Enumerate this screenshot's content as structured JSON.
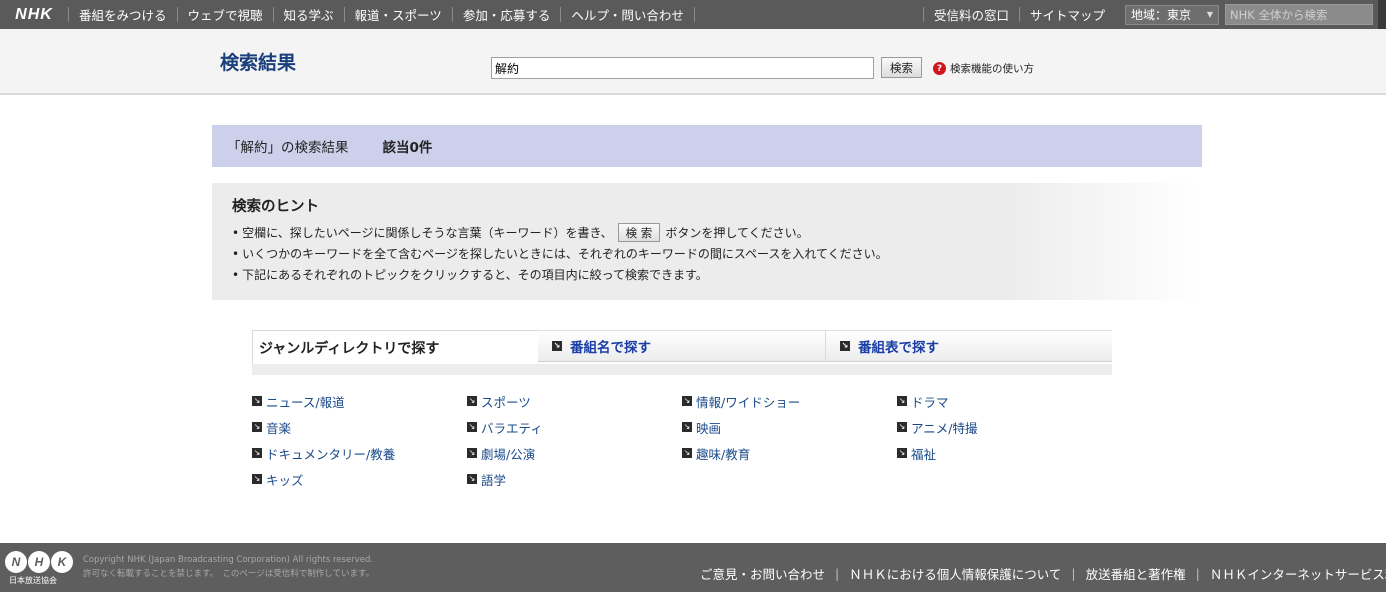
{
  "topnav": {
    "logo": "NHK",
    "items": [
      "番組をみつける",
      "ウェブで視聴",
      "知る学ぶ",
      "報道・スポーツ",
      "参加・応募する",
      "ヘルプ・問い合わせ"
    ],
    "right_items": [
      "受信料の窓口",
      "サイトマップ"
    ],
    "region_label": "地域：東京",
    "site_search_placeholder": "NHK 全体から検索"
  },
  "header": {
    "title": "検索結果",
    "query": "解約",
    "search_button": "検索",
    "help_link": "検索機能の使い方",
    "help_icon_glyph": "?"
  },
  "results": {
    "label": "「解約」の検索結果",
    "count": "該当0件"
  },
  "hints": {
    "title": "検索のヒント",
    "line1_before": "空欄に、探したいページに関係しそうな言葉（キーワード）を書き、",
    "line1_button": "検 索",
    "line1_after": "ボタンを押してください。",
    "line2": "いくつかのキーワードを全て含むページを探したいときには、それぞれのキーワードの間にスペースを入れてください。",
    "line3": "下記にあるそれぞれのトピックをクリックすると、その項目内に絞って検索できます。"
  },
  "tabs": {
    "genre": "ジャンルディレクトリで探す",
    "program_name": "番組名で探す",
    "schedule": "番組表で探す"
  },
  "genres": [
    "ニュース/報道",
    "スポーツ",
    "情報/ワイドショー",
    "ドラマ",
    "音楽",
    "バラエティ",
    "映画",
    "アニメ/特撮",
    "ドキュメンタリー/教養",
    "劇場/公演",
    "趣味/教育",
    "福祉",
    "キッズ",
    "語学"
  ],
  "footer": {
    "logo_letters": [
      "N",
      "H",
      "K"
    ],
    "logo_sub": "日本放送協会",
    "copyright": "Copyright NHK (Japan Broadcasting Corporation) All rights reserved.",
    "notice": "許可なく転載することを禁じます。　このページは受信料で制作しています。",
    "links": [
      "ご意見・お問い合わせ",
      "ＮＨＫにおける個人情報保護について",
      "放送番組と著作権",
      "ＮＨＫインターネットサービス利用規約"
    ]
  }
}
